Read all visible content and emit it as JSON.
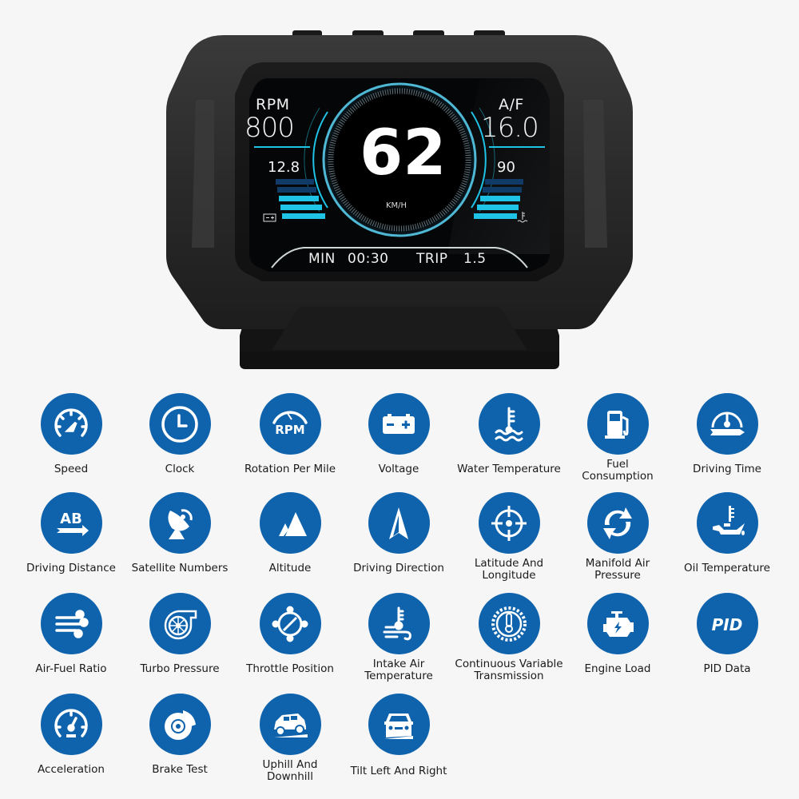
{
  "device": {
    "screen": {
      "rpm_label": "RPM",
      "rpm_value": "800",
      "af_label": "A/F",
      "af_value": "16.0",
      "voltage_value": "12.8",
      "water_temp_value": "90",
      "speed_value": "62",
      "speed_unit": "KM/H",
      "min_label": "MIN",
      "min_value": "00:30",
      "trip_label": "TRIP",
      "trip_value": "1.5",
      "voltage_bar_level": "3/5",
      "water_temp_bar_level": "3/5",
      "accent_color": "#1ec3e6",
      "dim_bar_color": "#0f3b66"
    },
    "buttons": [
      "button-1",
      "button-2",
      "button-3",
      "button-4"
    ]
  },
  "features": [
    {
      "label": "Speed",
      "icon": "speedometer-icon"
    },
    {
      "label": "Clock",
      "icon": "clock-icon"
    },
    {
      "label": "Rotation Per Mile",
      "icon": "rpm-gauge-icon",
      "icon_text": "RPM"
    },
    {
      "label": "Voltage",
      "icon": "battery-icon"
    },
    {
      "label": "Water Temperature",
      "icon": "water-temperature-icon"
    },
    {
      "label": "Fuel Consumption",
      "icon": "fuel-pump-icon"
    },
    {
      "label": "Driving Time",
      "icon": "driving-time-icon"
    },
    {
      "label": "Driving Distance",
      "icon": "ab-distance-icon",
      "icon_text": "AB"
    },
    {
      "label": "Satellite Numbers",
      "icon": "satellite-dish-icon"
    },
    {
      "label": "Altitude",
      "icon": "mountain-icon"
    },
    {
      "label": "Driving Direction",
      "icon": "compass-arrow-icon"
    },
    {
      "label": "Latitude And Longitude",
      "icon": "crosshair-icon"
    },
    {
      "label": "Manifold Air Pressure",
      "icon": "recycle-arrows-icon"
    },
    {
      "label": "Oil Temperature",
      "icon": "oil-can-temperature-icon"
    },
    {
      "label": "Air-Fuel Ratio",
      "icon": "wind-icon"
    },
    {
      "label": "Turbo Pressure",
      "icon": "turbo-icon"
    },
    {
      "label": "Throttle Position",
      "icon": "throttle-icon"
    },
    {
      "label": "Intake Air Temperature",
      "icon": "intake-air-temperature-icon"
    },
    {
      "label": "Continuous Variable Transmission",
      "icon": "gear-thermometer-icon"
    },
    {
      "label": "Engine Load",
      "icon": "engine-icon"
    },
    {
      "label": "PID Data",
      "icon": "pid-icon",
      "icon_text": "PID"
    },
    {
      "label": "Acceleration",
      "icon": "acceleration-gauge-icon"
    },
    {
      "label": "Brake Test",
      "icon": "brake-disc-icon"
    },
    {
      "label": "Uphill And Downhill",
      "icon": "car-side-slope-icon"
    },
    {
      "label": "Tilt Left And Right",
      "icon": "car-front-tilt-icon"
    }
  ],
  "colors": {
    "icon_circle": "#0f63ad",
    "background": "#f6f6f6"
  }
}
